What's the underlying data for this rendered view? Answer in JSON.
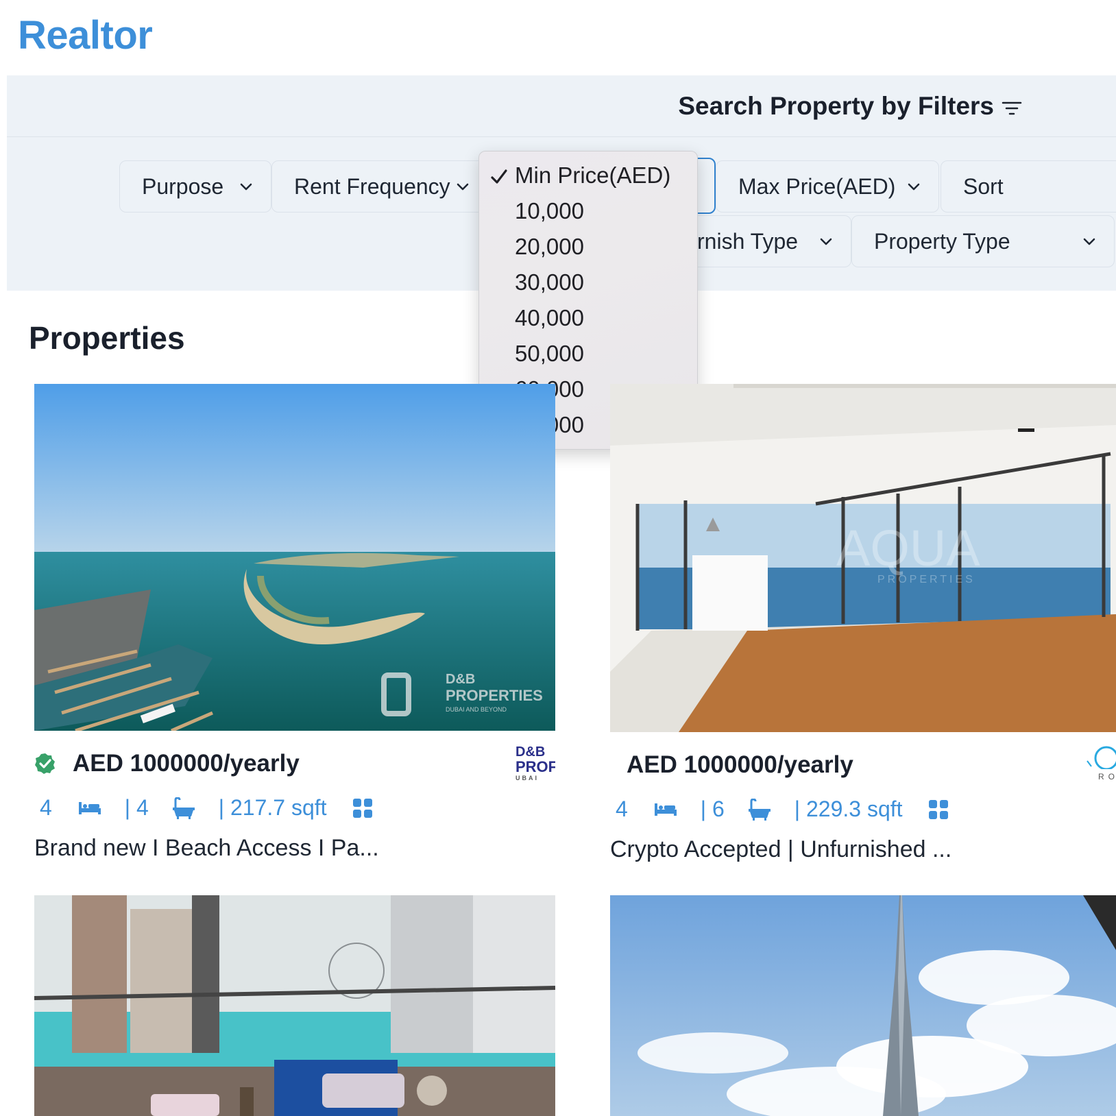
{
  "app": {
    "logo": "Realtor"
  },
  "filters": {
    "title": "Search Property by Filters",
    "selects": {
      "purpose": "Purpose",
      "rent_frequency": "Rent Frequency",
      "max_price": "Max Price(AED)",
      "sort": "Sort",
      "furnish_type": "Furnish Type",
      "furnish_type_visible": "rnish Type",
      "property_type": "Property Type"
    },
    "min_price_dropdown": {
      "selected": "Min Price(AED)",
      "options": [
        "Min Price(AED)",
        "10,000",
        "20,000",
        "30,000",
        "40,000",
        "50,000",
        "60,000",
        "85,000"
      ]
    }
  },
  "main": {
    "heading": "Properties",
    "cards": [
      {
        "price": "AED 1000000/yearly",
        "verified": true,
        "rooms": "4",
        "baths": "| 4",
        "area": "| 217.7 sqft",
        "title": "Brand new I Beach Access I Pa...",
        "agency_logo": [
          "D&B",
          "PROF",
          "UBAI"
        ],
        "watermark": [
          "D&B",
          "PROPERTIES",
          "DUBAI AND BEYOND"
        ]
      },
      {
        "price": "AED 1000000/yearly",
        "verified": false,
        "rooms": "4",
        "baths": "| 6",
        "area": "| 229.3 sqft",
        "title": "Crypto Accepted | Unfurnished ...",
        "agency_logo": [
          "RO"
        ],
        "watermark": [
          "AQUA",
          "PROPERTIES"
        ]
      },
      {
        "price": "",
        "title": ""
      },
      {
        "price": "",
        "title": ""
      }
    ]
  },
  "colors": {
    "accent": "#3d8fd9",
    "panel": "#edf2f7",
    "verified": "#38a169"
  }
}
